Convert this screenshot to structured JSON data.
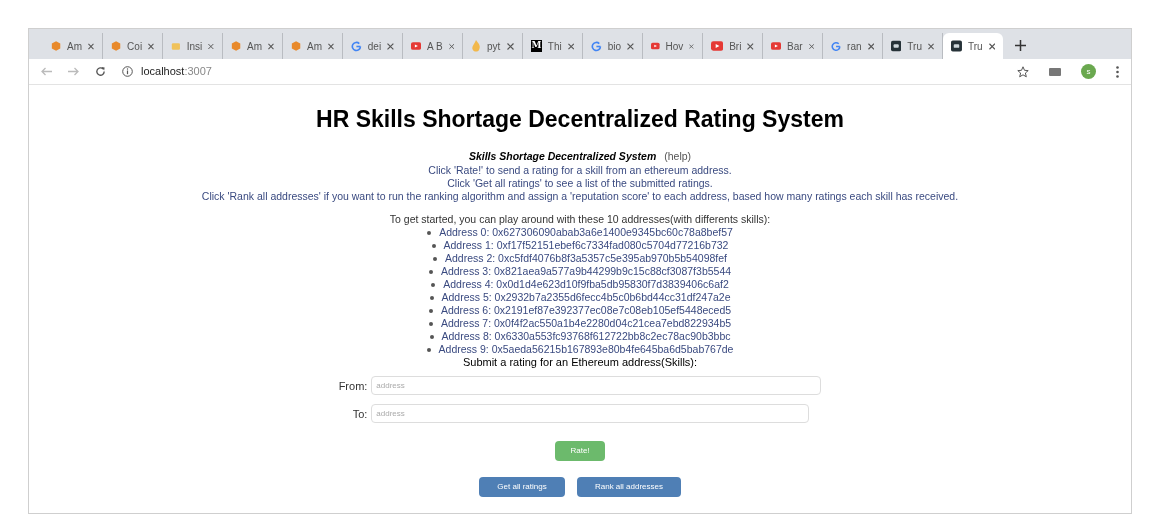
{
  "tabs": [
    {
      "label": "Am",
      "kind": "box",
      "selected": false
    },
    {
      "label": "Coi",
      "kind": "box",
      "selected": false
    },
    {
      "label": "Insi",
      "kind": "folder",
      "selected": false
    },
    {
      "label": "Am",
      "kind": "box",
      "selected": false
    },
    {
      "label": "Am",
      "kind": "box",
      "selected": false
    },
    {
      "label": "dei",
      "kind": "google",
      "selected": false
    },
    {
      "label": "A B",
      "kind": "video",
      "selected": false
    },
    {
      "label": "pyt",
      "kind": "flame",
      "selected": false
    },
    {
      "label": "Thi",
      "kind": "letter",
      "favicon_text": "M",
      "selected": false
    },
    {
      "label": "bio",
      "kind": "google",
      "selected": false
    },
    {
      "label": "Hov",
      "kind": "video",
      "selected": false
    },
    {
      "label": "Bri",
      "kind": "video",
      "selected": false
    },
    {
      "label": "Bar",
      "kind": "video",
      "selected": false
    },
    {
      "label": "ran",
      "kind": "google",
      "selected": false
    },
    {
      "label": "Tru",
      "kind": "dark",
      "selected": false
    },
    {
      "label": "Tru",
      "kind": "dark",
      "selected": true
    }
  ],
  "address_bar": {
    "host": "localhost",
    "port": ":3007"
  },
  "profile_initial": "s",
  "page": {
    "title": "HR Skills Shortage Decentralized Rating System",
    "subtitle": "Skills Shortage Decentralized System",
    "help_link": "(help)",
    "instructions": [
      "Click 'Rate!' to send a rating for a skill from an ethereum address.",
      "Click 'Get all ratings' to see a list of the submitted ratings.",
      "Click 'Rank all addresses' if you want to run the ranking algorithm and assign a 'reputation score' to each address, based how many ratings each skill has received."
    ],
    "addresses_intro": "To get started, you can play around with these 10 addresses(with differents skills):",
    "addresses": [
      "Address 0: 0x627306090abab3a6e1400e9345bc60c78a8bef57",
      "Address 1: 0xf17f52151ebef6c7334fad080c5704d77216b732",
      "Address 2: 0xc5fdf4076b8f3a5357c5e395ab970b5b54098fef",
      "Address 3: 0x821aea9a577a9b44299b9c15c88cf3087f3b5544",
      "Address 4: 0x0d1d4e623d10f9fba5db95830f7d3839406c6af2",
      "Address 5: 0x2932b7a2355d6fecc4b5c0b6bd44cc31df247a2e",
      "Address 6: 0x2191ef87e392377ec08e7c08eb105ef5448eced5",
      "Address 7: 0x0f4f2ac550a1b4e2280d04c21cea7ebd822934b5",
      "Address 8: 0x6330a553fc93768f612722bb8c2ec78ac90b3bbc",
      "Address 9: 0x5aeda56215b167893e80b4fe645ba6d5bab767de"
    ],
    "form_heading": "Submit a rating for an Ethereum address(Skills):",
    "fields": [
      {
        "label": "From:",
        "placeholder": "address"
      },
      {
        "label": "To:",
        "placeholder": "address"
      }
    ],
    "rate_button": "Rate!",
    "buttons": [
      "Get all ratings",
      "Rank all addresses"
    ]
  }
}
